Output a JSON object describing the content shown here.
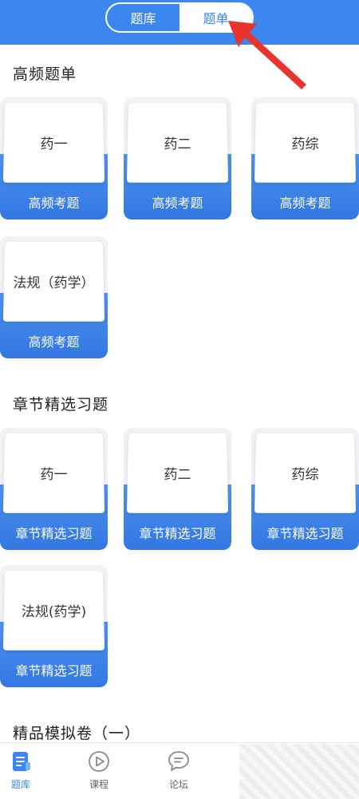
{
  "header": {
    "tabs": [
      {
        "label": "题库",
        "active": false
      },
      {
        "label": "题单",
        "active": true
      }
    ],
    "color": "#3b86f0"
  },
  "sections": [
    {
      "title": "高频题单",
      "cards": [
        {
          "name": "药一",
          "footer": "高频考题"
        },
        {
          "name": "药二",
          "footer": "高频考题"
        },
        {
          "name": "药综",
          "footer": "高频考题"
        },
        {
          "name": "法规（药学）",
          "footer": "高频考题"
        }
      ]
    },
    {
      "title": "章节精选习题",
      "cards": [
        {
          "name": "药一",
          "footer": "章节精选习题"
        },
        {
          "name": "药二",
          "footer": "章节精选习题"
        },
        {
          "name": "药综",
          "footer": "章节精选习题"
        },
        {
          "name": "法规(药学)",
          "footer": "章节精选习题"
        }
      ]
    },
    {
      "title": "精品模拟卷（一）",
      "cards": []
    }
  ],
  "tabbar": {
    "items": [
      {
        "label": "题库",
        "icon": "question-bank-icon",
        "active": true
      },
      {
        "label": "课程",
        "icon": "play-circle-icon",
        "active": false
      },
      {
        "label": "论坛",
        "icon": "chat-bubble-icon",
        "active": false
      }
    ]
  },
  "colors": {
    "accent": "#3b86f0",
    "card_footer": "#3277e2",
    "arrow": "#e8332e"
  }
}
